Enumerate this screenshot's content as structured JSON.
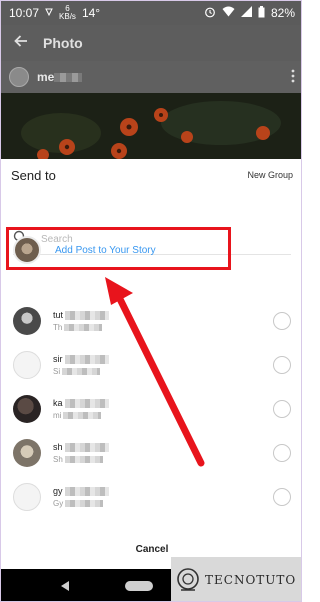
{
  "status_bar": {
    "time": "10:07",
    "data_rate_top": "6",
    "data_rate_bottom": "KB/s",
    "temperature": "14°",
    "battery": "82%"
  },
  "app_bar": {
    "title": "Photo"
  },
  "post": {
    "username_visible": "me"
  },
  "sheet": {
    "title": "Send to",
    "new_group_label": "New Group",
    "search_placeholder": "Search",
    "story_label": "Add Post to Your Story",
    "cancel_label": "Cancel"
  },
  "contacts": [
    {
      "name_prefix": "tut",
      "sub_prefix": "Th"
    },
    {
      "name_prefix": "sir",
      "sub_prefix": "Si"
    },
    {
      "name_prefix": "ka",
      "sub_prefix": "mi"
    },
    {
      "name_prefix": "sh",
      "sub_prefix": "Sh"
    },
    {
      "name_prefix": "gy",
      "sub_prefix": "Gy"
    }
  ],
  "watermark": {
    "text": "TECNOTUTO"
  },
  "colors": {
    "accent": "#3897f0",
    "annotation": "#e8141c",
    "dim_overlay": "#5d5d5d"
  },
  "icons": {
    "back": "arrow-left-icon",
    "search": "search-icon",
    "more": "more-vertical-icon",
    "alarm": "alarm-icon",
    "wifi": "wifi-icon",
    "signal": "signal-icon",
    "battery": "battery-icon"
  }
}
